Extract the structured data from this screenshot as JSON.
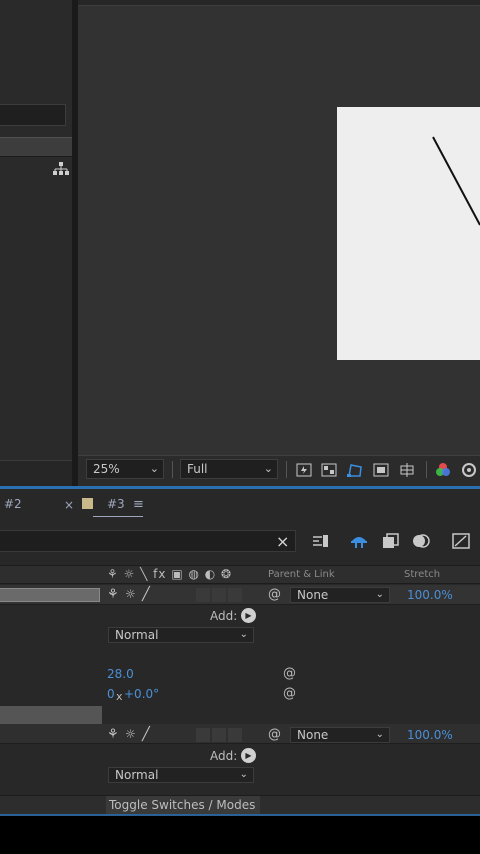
{
  "viewer": {
    "zoom": "25%",
    "resolution": "Full"
  },
  "timeline": {
    "tab_prev": "#2",
    "tab_close": "×",
    "tab_active": "#3",
    "tab_menu": "≡",
    "search_clear": "×",
    "columns": {
      "switches_icons": "⚘ ☼ ╲ fx ▣ ◍ ◐ ❂",
      "parent_link": "Parent & Link",
      "stretch": "Stretch"
    },
    "layer1": {
      "parent": "None",
      "stretch": "100.0%",
      "add_label": "Add:",
      "blend_mode": "Normal",
      "prop_value_1": "28.0",
      "prop_value_2_a": "0",
      "prop_value_2_x": "x",
      "prop_value_2_b": "+0.0°"
    },
    "layer2": {
      "parent": "None",
      "stretch": "100.0%",
      "add_label": "Add:",
      "blend_mode": "Normal"
    },
    "toggle_label": "Toggle Switches / Modes"
  },
  "icons": {
    "dropdown_arrow": "⌄",
    "add_arrow": "▶",
    "spiral": "@",
    "solo": "☼",
    "shy": "⚘",
    "pen": "╱"
  },
  "colors": {
    "accent_blue": "#2a6fb1",
    "value_blue": "#4b8fd6",
    "canvas": "#eeeeee"
  }
}
